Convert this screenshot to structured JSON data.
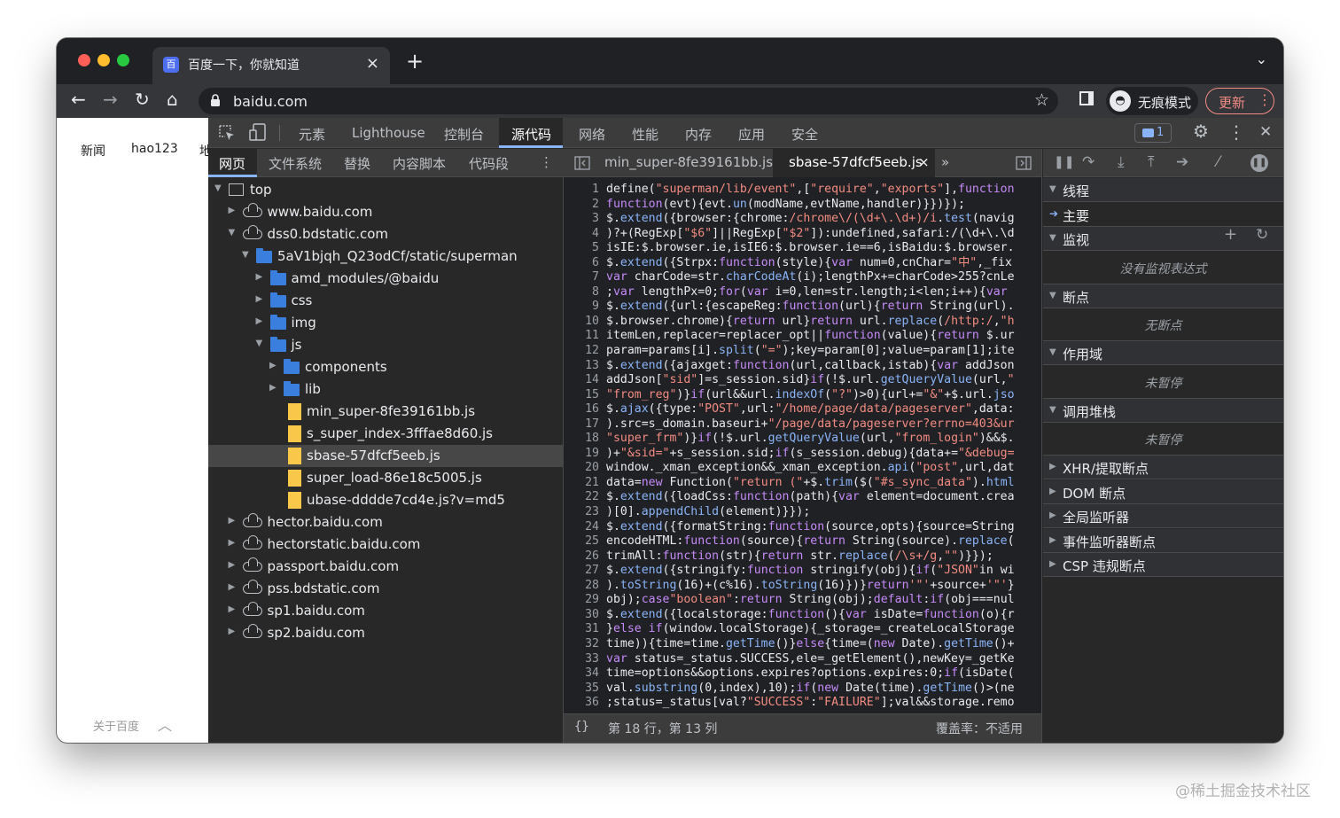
{
  "browser": {
    "tab_title": "百度一下，你就知道",
    "tab_close": "×",
    "new_tab": "+",
    "tab_list": "⌄",
    "url": "baidu.com",
    "incognito_label": "无痕模式",
    "update_label": "更新",
    "kebab": "⋮",
    "back": "←",
    "forward": "→",
    "reload": "↻",
    "home": "⌂",
    "bookmark": "☆",
    "traffic_colors": [
      "#ff5f57",
      "#febc2e",
      "#28c840"
    ]
  },
  "page": {
    "links": [
      "新闻",
      "hao123",
      "地"
    ],
    "footer": "关于百度",
    "footer_chevron": "︿"
  },
  "devtools": {
    "main_tabs": [
      "元素",
      "Lighthouse",
      "控制台",
      "源代码",
      "网络",
      "性能",
      "内存",
      "应用",
      "安全"
    ],
    "active_main_tab": "源代码",
    "issues_count": "1",
    "gear": "⚙",
    "kebab": "⋮",
    "close": "✕",
    "sub_tabs": [
      "网页",
      "文件系统",
      "替换",
      "内容脚本",
      "代码段"
    ],
    "sub_more": "⋮",
    "tree": [
      {
        "label": "top",
        "type": "frame",
        "depth": 0,
        "arrow": "▼"
      },
      {
        "label": "www.baidu.com",
        "type": "cloud",
        "depth": 1,
        "arrow": "▶"
      },
      {
        "label": "dss0.bdstatic.com",
        "type": "cloud",
        "depth": 1,
        "arrow": "▼"
      },
      {
        "label": "5aV1bjqh_Q23odCf/static/superman",
        "type": "folder",
        "depth": 2,
        "arrow": "▼"
      },
      {
        "label": "amd_modules/@baidu",
        "type": "folder",
        "depth": 3,
        "arrow": "▶"
      },
      {
        "label": "css",
        "type": "folder",
        "depth": 3,
        "arrow": "▶"
      },
      {
        "label": "img",
        "type": "folder",
        "depth": 3,
        "arrow": "▶"
      },
      {
        "label": "js",
        "type": "folder",
        "depth": 3,
        "arrow": "▼"
      },
      {
        "label": "components",
        "type": "folder",
        "depth": 4,
        "arrow": "▶"
      },
      {
        "label": "lib",
        "type": "folder",
        "depth": 4,
        "arrow": "▶"
      },
      {
        "label": "min_super-8fe39161bb.js",
        "type": "file",
        "depth": 4,
        "arrow": ""
      },
      {
        "label": "s_super_index-3fffae8d60.js",
        "type": "file",
        "depth": 4,
        "arrow": ""
      },
      {
        "label": "sbase-57dfcf5eeb.js",
        "type": "file",
        "depth": 4,
        "arrow": "",
        "selected": true
      },
      {
        "label": "super_load-86e18c5005.js",
        "type": "file",
        "depth": 4,
        "arrow": ""
      },
      {
        "label": "ubase-dddde7cd4e.js?v=md5",
        "type": "file",
        "depth": 4,
        "arrow": ""
      },
      {
        "label": "hector.baidu.com",
        "type": "cloud",
        "depth": 1,
        "arrow": "▶"
      },
      {
        "label": "hectorstatic.baidu.com",
        "type": "cloud",
        "depth": 1,
        "arrow": "▶"
      },
      {
        "label": "passport.baidu.com",
        "type": "cloud",
        "depth": 1,
        "arrow": "▶"
      },
      {
        "label": "pss.bdstatic.com",
        "type": "cloud",
        "depth": 1,
        "arrow": "▶"
      },
      {
        "label": "sp1.baidu.com",
        "type": "cloud",
        "depth": 1,
        "arrow": "▶"
      },
      {
        "label": "sp2.baidu.com",
        "type": "cloud",
        "depth": 1,
        "arrow": "▶"
      }
    ],
    "editor_tabs": [
      "min_super-8fe39161bb.js",
      "sbase-57dfcf5eeb.js"
    ],
    "editor_tab_close": "×",
    "editor_more": "»",
    "code_lines": [
      "define(\"superman/lib/event\",[\"require\",\"exports\"],function",
      "function(evt){evt.un(modName,evtName,handler)}})});",
      "$.extend({browser:{chrome:/chrome\\/(\\d+\\.\\d+)/i.test(navig",
      ")?+(RegExp[\"$6\"]||RegExp[\"$2\"]):undefined,safari:/(\\d+\\.\\d",
      "isIE:$.browser.ie,isIE6:$.browser.ie==6,isBaidu:$.browser.",
      "$.extend({Strpx:function(style){var num=0,cnChar=\"中\",_fix",
      "var charCode=str.charCodeAt(i);lengthPx+=charCode>255?cnLe",
      ";var lengthPx=0;for(var i=0,len=str.length;i<len;i++){var",
      "$.extend({url:{escapeReg:function(url){return String(url).",
      "$.browser.chrome){return url}return url.replace(/http:/,\"h",
      "itemLen,replacer=replacer_opt||function(value){return $.ur",
      "param=params[i].split(\"=\");key=param[0];value=param[1];ite",
      "$.extend({ajaxget:function(url,callback,istab){var addJson",
      "addJson[\"sid\"]=s_session.sid}if(!$.url.getQueryValue(url,\"",
      "\"from_reg\")}if(url&&url.indexOf(\"?\")>0){url+=\"&\"+$.url.jso",
      "$.ajax({type:\"POST\",url:\"/home/page/data/pageserver\",data:",
      ").src=s_domain.baseuri+\"/page/data/pageserver?errno=403&ur",
      "\"super_frm\")}if(!$.url.getQueryValue(url,\"from_login\")&&$.",
      ")+\"&sid=\"+s_session.sid;if(s_session.debug){data+=\"&debug=",
      "window._xman_exception&&_xman_exception.api(\"post\",url,dat",
      "data=new Function(\"return (\"+$.trim($(\"#s_sync_data\").html",
      "$.extend({loadCss:function(path){var element=document.crea",
      ")[0].appendChild(element)}});",
      "$.extend({formatString:function(source,opts){source=String",
      "encodeHTML:function(source){return String(source).replace(",
      "trimAll:function(str){return str.replace(/\\s+/g,\"\")}});",
      "$.extend({stringify:function stringify(obj){if(\"JSON\"in wi",
      ").toString(16)+(c%16).toString(16)})}return'\"'+source+'\"'}",
      "obj);case\"boolean\":return String(obj);default:if(obj===nul",
      "$.extend({localstorage:function(){var isDate=function(o){r",
      "}else if(window.localStorage){_storage=_createLocalStorage",
      "time)){time=time.getTime()}else{time=(new Date).getTime()+",
      "var status=_status.SUCCESS,ele=_getElement(),newKey=_getKe",
      "time=options&&options.expires?options.expires:0;if(isDate(",
      "val.substring(0,index),10);if(new Date(time).getTime()>(ne",
      ";status=_status[val?\"SUCCESS\":\"FAILURE\"];val&&storage.remo"
    ],
    "status_braces": "{}",
    "status_position": "第 18 行，第 13 列",
    "status_coverage": "覆盖率：不适用",
    "sections": [
      {
        "label": "线程",
        "arrow": "▼"
      },
      {
        "label": "主要",
        "arrow": "➔"
      },
      {
        "label": "监视",
        "arrow": "▼"
      },
      {
        "label": "没有监视表达式",
        "empty": true
      },
      {
        "label": "断点",
        "arrow": "▼"
      },
      {
        "label": "无断点",
        "empty": true
      },
      {
        "label": "作用域",
        "arrow": "▼"
      },
      {
        "label": "未暂停",
        "empty": true
      },
      {
        "label": "调用堆栈",
        "arrow": "▼"
      },
      {
        "label": "未暂停",
        "empty": true
      },
      {
        "label": "XHR/提取断点",
        "arrow": "▶"
      },
      {
        "label": "DOM 断点",
        "arrow": "▶"
      },
      {
        "label": "全局监听器",
        "arrow": "▶"
      },
      {
        "label": "事件监听器断点",
        "arrow": "▶"
      },
      {
        "label": "CSP 违规断点",
        "arrow": "▶"
      }
    ],
    "watch_add": "+",
    "watch_refresh": "↻"
  },
  "watermark": "@稀土掘金技术社区",
  "colors": {
    "accent": "#8ab4f8",
    "folder": "#3a7fde",
    "file": "#f9c84a",
    "update": "#f28b82"
  }
}
